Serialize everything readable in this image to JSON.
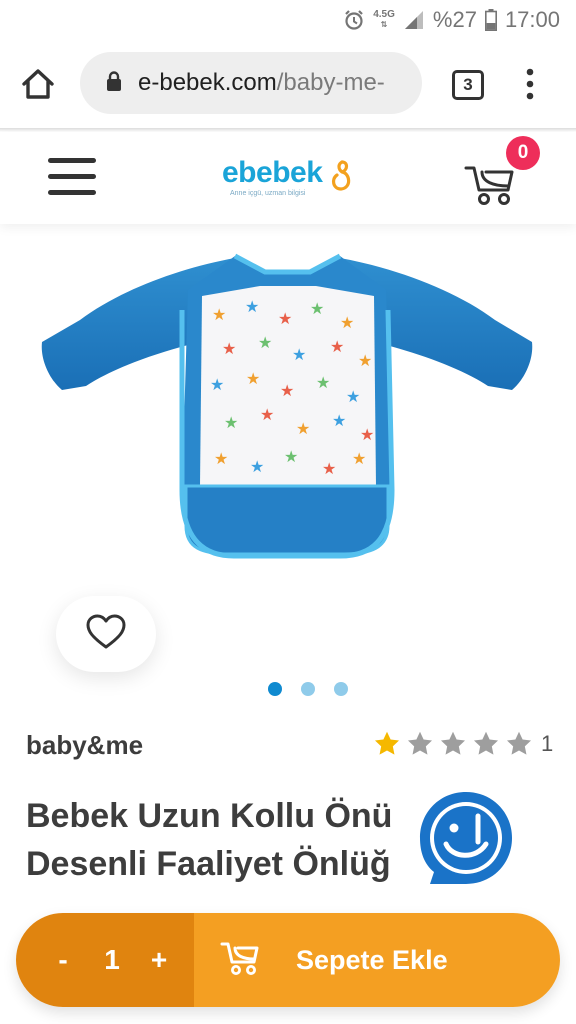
{
  "status_bar": {
    "network": "4.5G",
    "battery": "%27",
    "time": "17:00",
    "icons": [
      "alarm-icon",
      "signal-icon",
      "battery-icon"
    ]
  },
  "browser": {
    "url_domain": "e-bebek.com",
    "url_path": "/baby-me-",
    "tab_count": "3",
    "icons": [
      "home-icon",
      "lock-icon",
      "overflow-menu-icon"
    ]
  },
  "site_header": {
    "logo_text": "ebebek",
    "logo_tagline": "Anne içgü, uzman bilgisi",
    "cart_count": "0",
    "icons": [
      "hamburger-menu-icon",
      "stroller-cart-icon"
    ]
  },
  "gallery": {
    "slide_count": 3,
    "active_slide": 1,
    "icons": [
      "heart-icon"
    ]
  },
  "product": {
    "brand": "baby&me",
    "rating": 1,
    "rating_max": 5,
    "rating_count": "1",
    "title_line1": "Bebek Uzun Kollu Önü",
    "title_line2": "Desenli Faaliyet Önlüğ"
  },
  "purchase_bar": {
    "minus_label": "-",
    "quantity": "1",
    "plus_label": "+",
    "add_to_cart_label": "Sepete Ekle"
  },
  "colors": {
    "brand_blue": "#1aa4d8",
    "badge": "#ee2e5a",
    "quantity_bg": "#e0840f",
    "cart_button_bg": "#f49f22",
    "active_dot": "#0f8ad0",
    "inactive_dot": "#8fcbea",
    "chat_blue": "#1a73c8"
  }
}
